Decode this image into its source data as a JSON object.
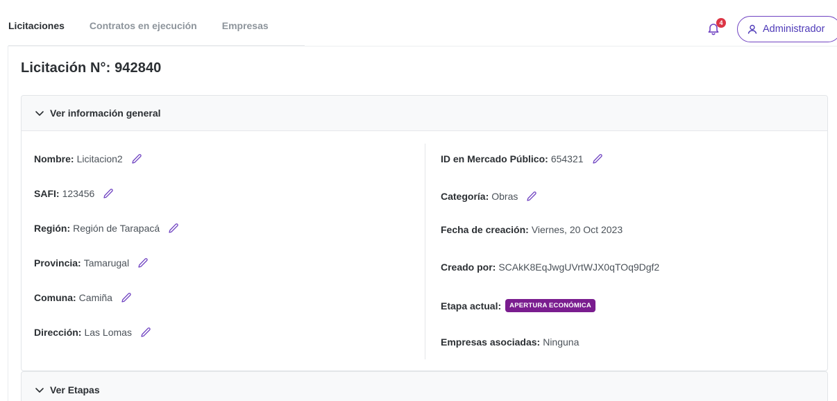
{
  "nav": {
    "tabs": [
      {
        "label": "Licitaciones",
        "active": true
      },
      {
        "label": "Contratos en ejecución",
        "active": false
      },
      {
        "label": "Empresas",
        "active": false
      }
    ],
    "notifications": {
      "count": "4",
      "icon": "bell-icon"
    },
    "user": {
      "label": "Administrador",
      "icon": "user-icon"
    }
  },
  "page": {
    "title": "Licitación N°: 942840"
  },
  "general": {
    "header": "Ver información general",
    "left": [
      {
        "key": "Nombre:",
        "value": "Licitacion2"
      },
      {
        "key": "SAFI:",
        "value": "123456"
      },
      {
        "key": "Región:",
        "value": "Región de Tarapacá"
      },
      {
        "key": "Provincia:",
        "value": "Tamarugal"
      },
      {
        "key": "Comuna:",
        "value": "Camiña"
      },
      {
        "key": "Dirección:",
        "value": "Las Lomas"
      }
    ],
    "right": {
      "mercado": {
        "key": "ID en Mercado Público:",
        "value": "654321"
      },
      "categoria": {
        "key": "Categoría:",
        "value": "Obras"
      },
      "fecha": {
        "key": "Fecha de creación:",
        "value": "Viernes, 20 Oct 2023"
      },
      "creado": {
        "key": "Creado por:",
        "value": "SCAkK8EqJwgUVrtWJX0qTOq9Dgf2"
      },
      "etapa": {
        "key": "Etapa actual:",
        "value": "APERTURA ECONÓMICA"
      },
      "empresas": {
        "key": "Empresas asociadas:",
        "value": "Ninguna"
      }
    }
  },
  "stages": {
    "header": "Ver Etapas"
  },
  "colors": {
    "accent": "#6f42c1",
    "stage_badge": "#7a1d8f",
    "notification": "#dc3545"
  }
}
